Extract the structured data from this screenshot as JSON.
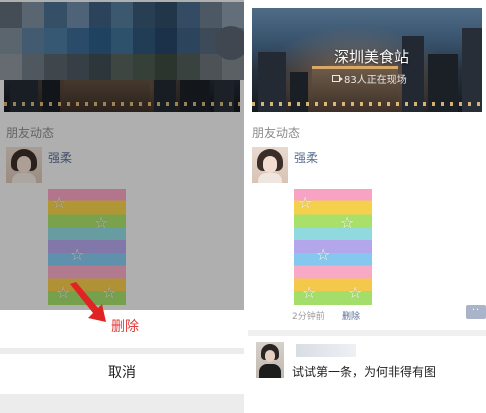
{
  "left_panel": {
    "section_title": "朋友动态",
    "post": {
      "username": "强柔"
    },
    "action_sheet": {
      "delete_label": "删除",
      "cancel_label": "取消"
    }
  },
  "right_panel": {
    "cover": {
      "title": "深圳美食站",
      "subtitle": "83人正在现场"
    },
    "section_title": "朋友动态",
    "post": {
      "username": "强柔",
      "time": "2分钟前",
      "delete_label": "删除",
      "more_icon": "more-icon"
    },
    "comment": {
      "text": "试试第一条，为何非得有图"
    }
  },
  "colors": {
    "username": "#5b6f95",
    "delete": "#e03b3b",
    "arrow": "#e02424"
  }
}
